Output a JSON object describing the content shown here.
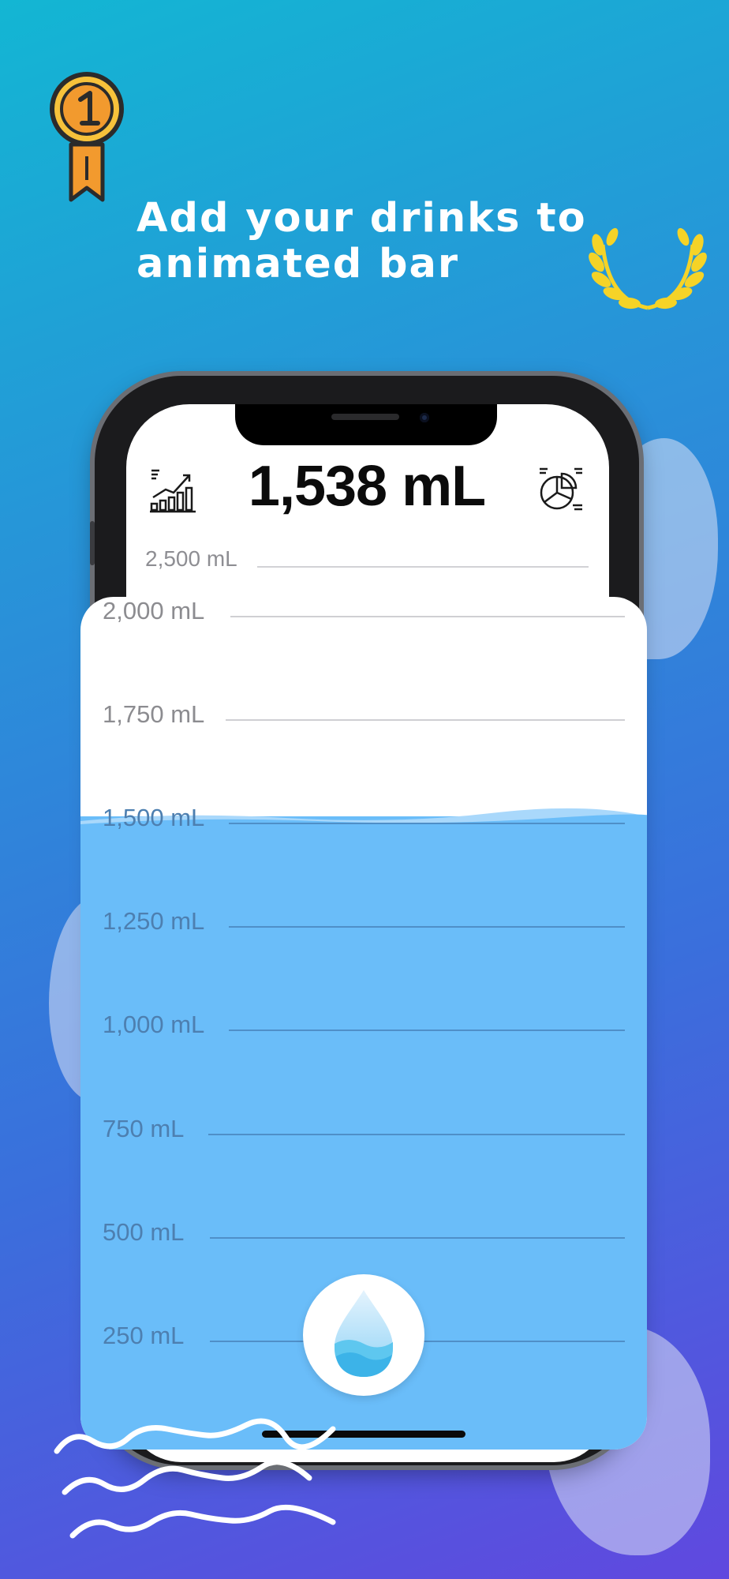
{
  "headline": {
    "line1": "Add your drinks to",
    "line2": "animated bar"
  },
  "tracker": {
    "total": "1,538 mL",
    "total_value_ml": 1538,
    "goal_ml": 2500,
    "scale_labels": [
      "2,500 mL",
      "2,000 mL",
      "1,750 mL",
      "1,500 mL",
      "1,250 mL",
      "1,000 mL",
      "750 mL",
      "500 mL",
      "250 mL"
    ]
  },
  "icons": {
    "medal": "medal-first-place-icon",
    "laurel": "laurel-wreath-icon",
    "stats": "growth-chart-icon",
    "pie": "pie-chart-icon",
    "drop": "water-drop-icon"
  },
  "colors": {
    "water": "#6abdf9",
    "medal_gold": "#f7c23b",
    "laurel": "#f5d327",
    "gradient_top": "#13b6d3",
    "gradient_bottom": "#6048df"
  }
}
